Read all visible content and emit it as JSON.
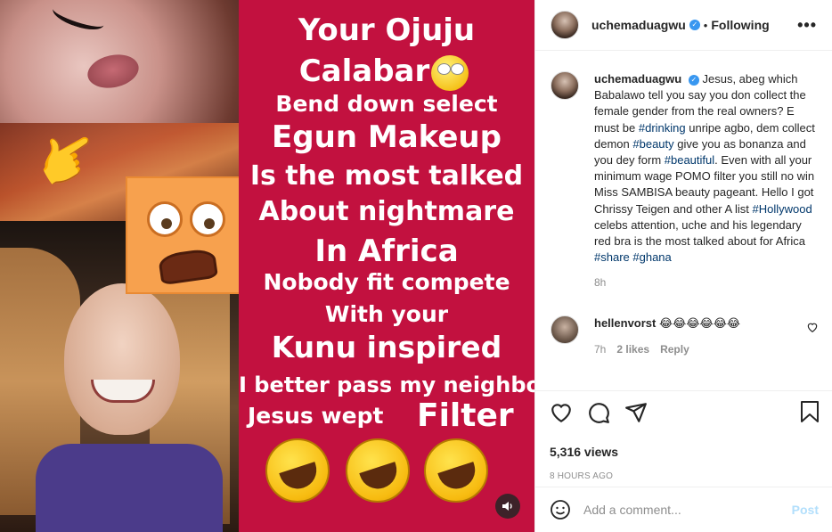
{
  "post": {
    "image_text": {
      "line1": "Your Ojuju",
      "line2": "Calabar",
      "line3": "Bend down select",
      "line4": "Egun Makeup",
      "line5": "Is the most talked",
      "line6": "About nightmare",
      "line7": "In Africa",
      "line8": "Nobody fit compete",
      "line9": "With your",
      "line10": "Kunu inspired",
      "line11": "I better pass my neighbor",
      "line12": "Jesus wept",
      "line13": "Filter"
    },
    "hand_emoji": "👉",
    "text_panel_color": "#c2113f"
  },
  "header": {
    "username": "uchemaduagwu",
    "verified_mark": "✓",
    "separator": "•",
    "follow_status": "Following",
    "more_icon": "•••"
  },
  "caption": {
    "username": "uchemaduagwu",
    "text_1": "Jesus, abeg which Babalawo tell you say you don collect the female gender from the real owners? E must be ",
    "tag_1": "#drinking",
    "text_2": " unripe agbo, dem collect demon ",
    "tag_2": "#beauty",
    "text_3": " give you as bonanza and you dey form ",
    "tag_3": "#beautiful",
    "text_4": ". Even with all your minimum wage POMO filter you still no win Miss SAMBISA beauty pageant. Hello I got Chrissy Teigen and other A list ",
    "tag_4": "#Hollywood",
    "text_5": " celebs attention, uche and his legendary red bra is the most talked about for Africa ",
    "tag_5": "#share",
    "tag_6": "#ghana",
    "time": "8h"
  },
  "comment": {
    "username": "hellenvorst",
    "text": "😂😂😂😂😂😂",
    "time": "7h",
    "likes": "2 likes",
    "reply": "Reply"
  },
  "stats": {
    "views": "5,316 views",
    "posted": "8 HOURS AGO"
  },
  "add_comment": {
    "placeholder": "Add a comment...",
    "post_label": "Post"
  },
  "colors": {
    "link": "#00376b",
    "verified": "#3897f0",
    "muted": "#8e8e8e",
    "post_disabled": "#b2dffc"
  }
}
